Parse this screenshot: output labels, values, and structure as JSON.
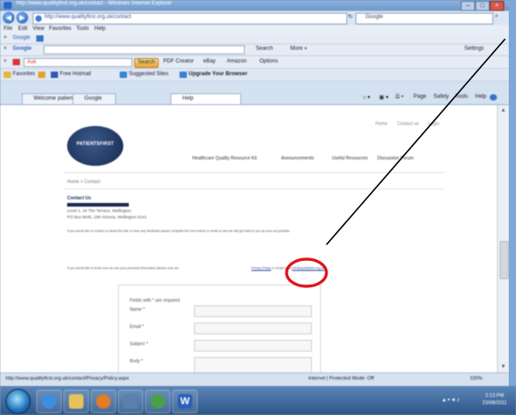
{
  "browser": {
    "title": "http://www.qualityfirst.org.uk/contact - Windows Internet Explorer",
    "url": "http://www.qualityfirst.org.uk/contact",
    "search_placeholder": "Google",
    "menu": [
      "File",
      "Edit",
      "View",
      "Favorites",
      "Tools",
      "Help"
    ],
    "toolbar_row1": "Google",
    "google_bar_search": "Search",
    "google_bar_more": "More »",
    "google_bar_settings": "Settings",
    "toolbar_row3_left": "Ask",
    "toolbar_row3_btn": "Search",
    "toolbar_row3_items": [
      "PDF Creator",
      "eBay",
      "Amazon",
      "Options"
    ],
    "favorites_label": "Favorites",
    "favorites_items": [
      "Free Hotmail",
      "Suggested Sites",
      "Upgrade Your Browser"
    ],
    "tabs": [
      "Welcome patients...",
      "Google",
      "Help"
    ],
    "right_tools": [
      "Page",
      "Safety",
      "Tools",
      "Help"
    ],
    "status_url": "http://www.qualityfirst.org.uk/contact/Privacy/Policy.aspx",
    "status_zone": "Internet | Protected Mode: Off",
    "status_zoom": "100%"
  },
  "page": {
    "logo_text": "PATIENTSFIRST",
    "top_links": [
      "Home",
      "Contact us",
      "Login"
    ],
    "nav": [
      "Healthcare Quality Resource Kit",
      "Announcements",
      "Useful Resources",
      "Discussion Forum"
    ],
    "breadcrumb": "Home > Contact",
    "contact_heading": "Contact Us",
    "address_line1": "Level 1, 44 The Terrace, Wellington",
    "address_line2": "PO Box 6645, 199 Victoria, Wellington 6141",
    "paragraph1": "If you would like to contact us about the site or have any feedback please complete the form below or email us and we will get back to you as soon as possible.",
    "paragraph2_pre": "If you would like to know how we use your personal information please read our",
    "paragraph2_link": "Privacy Policy",
    "paragraph2_post": "or email us at",
    "paragraph2_email": "info@qualityfirst.org.uk",
    "form_heading": "Fields with * are required",
    "form_fields": [
      "Name *",
      "Email *",
      "Subject *",
      "Body *"
    ]
  },
  "taskbar": {
    "time": "2:13 PM",
    "date": "23/08/2011"
  },
  "annotation": {
    "color": "#e0141b"
  }
}
